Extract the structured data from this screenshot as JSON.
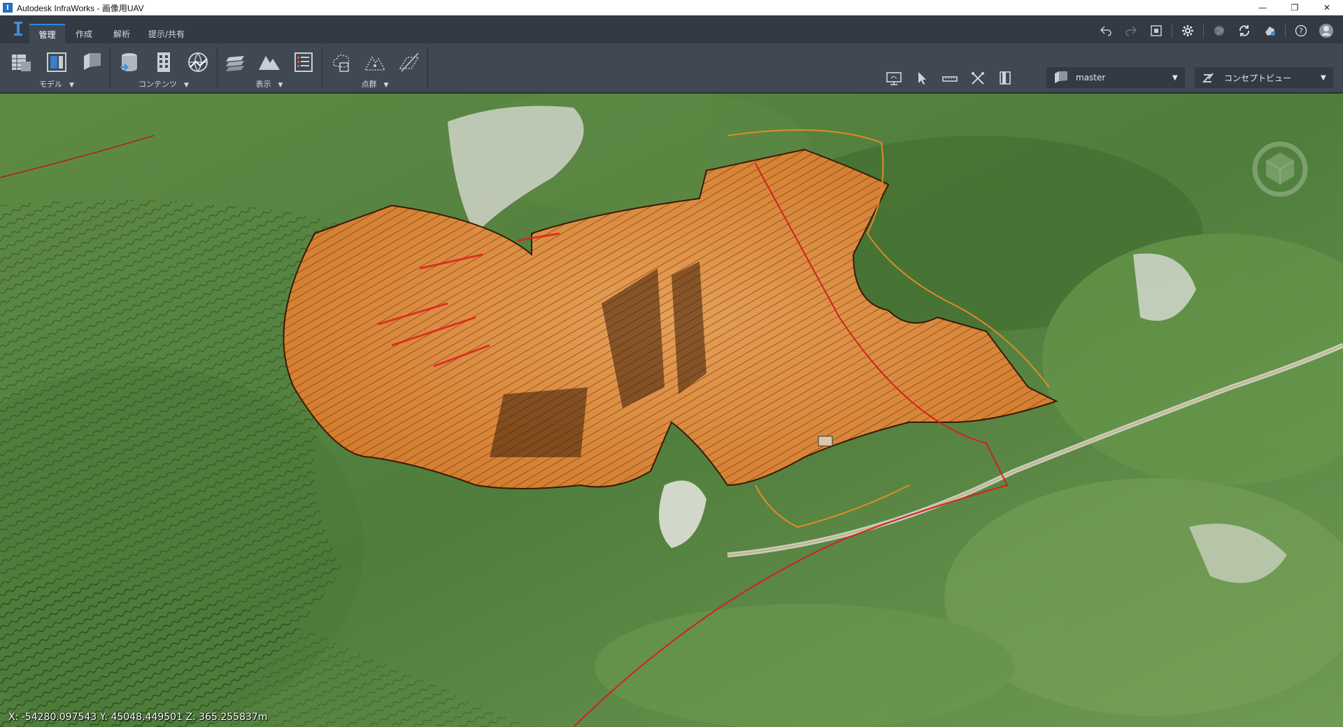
{
  "window": {
    "title": "Autodesk InfraWorks - 画像用UAV",
    "app_icon": "I",
    "controls": [
      "—",
      "❐",
      "✕"
    ]
  },
  "tabs": [
    {
      "label": "管理",
      "active": true
    },
    {
      "label": "作成",
      "active": false
    },
    {
      "label": "解析",
      "active": false
    },
    {
      "label": "提示/共有",
      "active": false
    }
  ],
  "ribbon": {
    "panels": [
      {
        "label": "モデル"
      },
      {
        "label": "コンテンツ"
      },
      {
        "label": "表示"
      },
      {
        "label": "点群"
      }
    ],
    "proposal_dropdown": {
      "value": "master"
    },
    "view_dropdown": {
      "value": "コンセプトビュー"
    }
  },
  "viewport": {
    "coordinates": "X: -54280.097543 Y: 45048.449501 Z: 365.255837m"
  },
  "colors": {
    "accent": "#2d88d8",
    "ribbon_bg": "#3f4853",
    "tab_bg": "#343a43",
    "overlay_orange": "#f08a36"
  },
  "icons": [
    "undo-icon",
    "redo-icon",
    "scene-icon",
    "settings-icon",
    "globe-icon",
    "sync-icon",
    "cloud-icon",
    "help-icon",
    "user-icon"
  ]
}
